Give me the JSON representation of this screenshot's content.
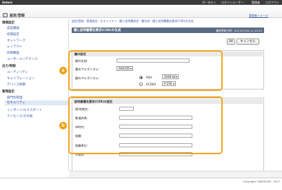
{
  "topbar": {
    "brand": "Satera",
    "links": [
      "ポータルへ",
      "ログインユーザー：",
      "管理者",
      "ログアウト"
    ]
  },
  "header": {
    "title": "設定/登録",
    "portal_link": "管理者へメール"
  },
  "sidebar": {
    "sections": [
      {
        "label": "環境設定",
        "items": [
          "認証機能",
          "初期設定",
          "ネットワーク",
          "レイアウト",
          "印刷機能",
          "ユーザーメンテナンス"
        ]
      },
      {
        "label": "出力/制御",
        "items": [
          "ユーティリティ",
          "キャリブレーション",
          "デバイス制御"
        ]
      },
      {
        "label": "管理設定",
        "items": [
          "部門別管理",
          "セキュリティ",
          "インポート/エクスポート",
          "ライセンス/その他"
        ]
      }
    ],
    "active_item": "セキュリティ"
  },
  "main": {
    "breadcrumb": "設定/登録：管理設定：セキュリティ：鍵と証明書設定：鍵生成：鍵と証明書署名要求(CSR)の生成",
    "title": "鍵と証明書署名要求(CSR)の生成",
    "timestamp": "最終更新日時：2017/07/26 11:10:22",
    "ok_label": "OK",
    "cancel_label": "キャンセル",
    "key_section": {
      "header": "鍵の設定",
      "name_label": "鍵の名前：",
      "sig_algo_label": "署名アルゴリズム：",
      "sig_algo_value": "SHA256",
      "key_algo_label": "鍵のアルゴリズム：",
      "rsa_label": "RSA",
      "rsa_bits": "2048 bit",
      "ecdsa_label": "ECDSA",
      "ecdsa_value": "P-256"
    },
    "csr_section": {
      "header": "証明書署名要求(CSR)の設定",
      "fields": [
        "国/地域名：",
        "都道府県：",
        "市町村：",
        "組織：",
        "組織単位：",
        "共通名："
      ]
    }
  },
  "footer": {
    "copyright": "Copyright CANON INC. 2017"
  },
  "callouts": [
    "a",
    "b"
  ],
  "colors": {
    "accent": "#f0a31a",
    "titlebar": "#5a6b84",
    "link": "#3355aa"
  }
}
